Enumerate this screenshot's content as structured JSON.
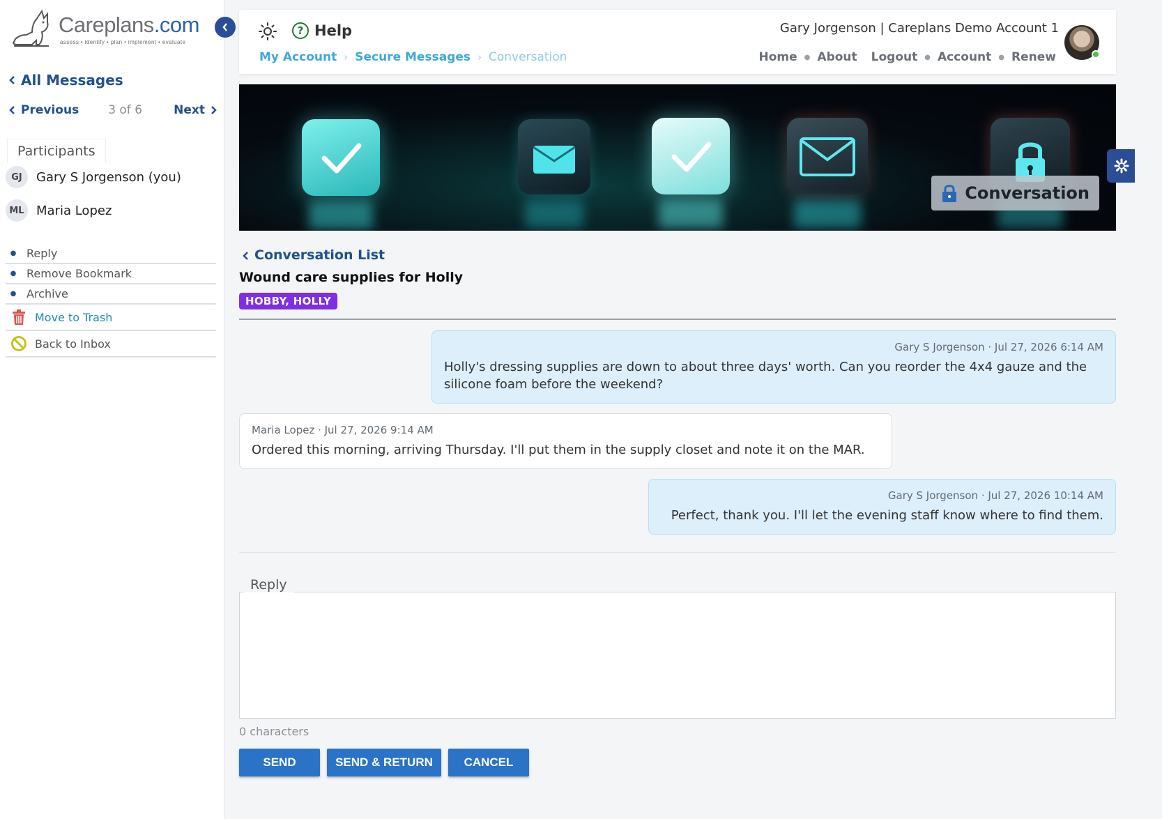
{
  "brand": {
    "name_main": "Careplans",
    "name_domain": ".com",
    "tagline": "assess • identify • plan • implement • evaluate"
  },
  "sidebar": {
    "all_messages": "All Messages",
    "pager": {
      "previous": "Previous",
      "count": "3 of 6",
      "next": "Next"
    },
    "participants_label": "Participants",
    "participants": [
      {
        "initials": "GJ",
        "name": "Gary S Jorgenson (you)"
      },
      {
        "initials": "ML",
        "name": "Maria Lopez"
      }
    ],
    "actions": [
      "Reply",
      "Remove Bookmark",
      "Archive"
    ],
    "move_to_trash": "Move to Trash",
    "back_to_inbox": "Back to Inbox"
  },
  "header": {
    "help": "Help",
    "breadcrumb": [
      "My Account",
      "Secure Messages",
      "Conversation"
    ],
    "user_line": "Gary Jorgenson | Careplans Demo Account 1",
    "nav": [
      "Home",
      "About",
      "Logout",
      "Account",
      "Renew"
    ]
  },
  "banner": {
    "title": "Conversation"
  },
  "conversation": {
    "back_link": "Conversation List",
    "subject": "Wound care supplies for Holly",
    "tag": "HOBBY, HOLLY",
    "messages": [
      {
        "author": "mine",
        "meta": "Gary S Jorgenson · Jul 27, 2026 6:14 AM",
        "body": "Holly's dressing supplies are down to about three days' worth. Can you reorder the 4x4 gauze and the silicone foam before the weekend?"
      },
      {
        "author": "theirs",
        "meta": "Maria Lopez · Jul 27, 2026 9:14 AM",
        "body": "Ordered this morning, arriving Thursday. I'll put them in the supply closet and note it on the MAR."
      },
      {
        "author": "mine",
        "meta": "Gary S Jorgenson · Jul 27, 2026 10:14 AM",
        "body": "Perfect, thank you. I'll let the evening staff know where to find them."
      }
    ]
  },
  "reply": {
    "legend": "Reply",
    "value": "",
    "char_count": "0 characters",
    "send": "SEND",
    "send_return": "SEND & RETURN",
    "cancel": "CANCEL"
  },
  "colors": {
    "primary_navy": "#22508f",
    "link_light": "#3fa9d8",
    "tag_purple": "#7e2fe3",
    "button_blue": "#2a73c6",
    "mine_bubble": "#ddeffb"
  }
}
